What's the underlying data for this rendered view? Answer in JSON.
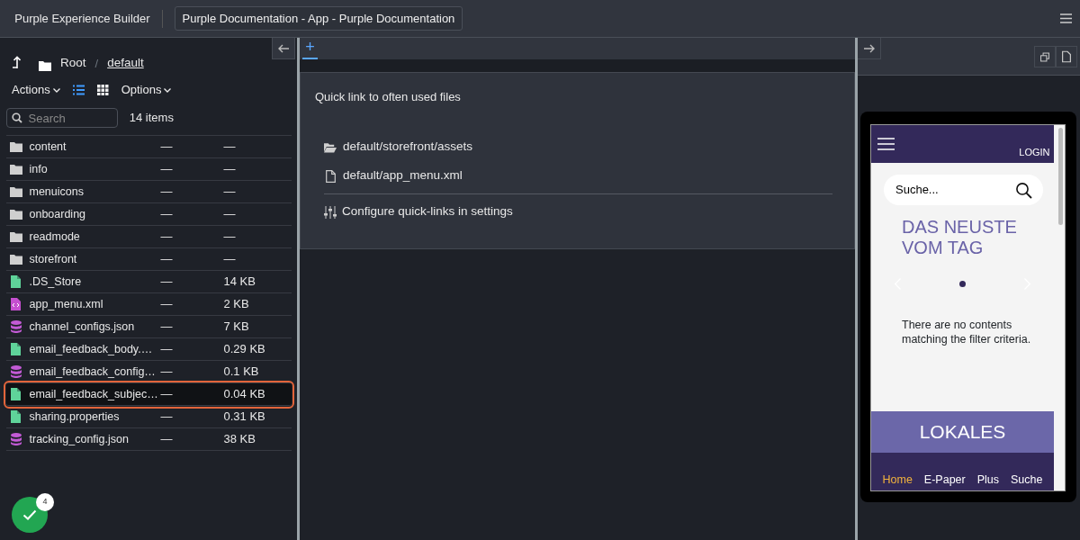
{
  "app": {
    "title": "Purple Experience Builder",
    "project": "Purple Documentation - App - Purple Documentation"
  },
  "browser": {
    "breadcrumb": [
      {
        "label": "Root",
        "current": false
      },
      {
        "label": "default",
        "current": true
      }
    ],
    "separator": "/",
    "actions": "Actions",
    "options": "Options",
    "view_modes": [
      {
        "kind": "list",
        "selected": true
      },
      {
        "kind": "grid",
        "selected": false
      }
    ],
    "search": {
      "placeholder": "Search"
    },
    "count": "14 items",
    "files": [
      {
        "kind": "folder",
        "name": "content",
        "modified": "—",
        "size": "—",
        "selected": false
      },
      {
        "kind": "folder",
        "name": "info",
        "modified": "—",
        "size": "—",
        "selected": false
      },
      {
        "kind": "folder",
        "name": "menuicons",
        "modified": "—",
        "size": "—",
        "selected": false
      },
      {
        "kind": "folder",
        "name": "onboarding",
        "modified": "—",
        "size": "—",
        "selected": false
      },
      {
        "kind": "folder",
        "name": "readmode",
        "modified": "—",
        "size": "—",
        "selected": false
      },
      {
        "kind": "folder",
        "name": "storefront",
        "modified": "—",
        "size": "—",
        "selected": false
      },
      {
        "kind": "file",
        "name": ".DS_Store",
        "modified": "—",
        "size": "14 KB",
        "selected": false
      },
      {
        "kind": "code",
        "name": "app_menu.xml",
        "modified": "—",
        "size": "2 KB",
        "selected": false
      },
      {
        "kind": "data",
        "name": "channel_configs.json",
        "modified": "—",
        "size": "7 KB",
        "selected": false
      },
      {
        "kind": "file",
        "name": "email_feedback_body.…",
        "modified": "—",
        "size": "0.29 KB",
        "selected": false
      },
      {
        "kind": "data",
        "name": "email_feedback_config…",
        "modified": "—",
        "size": "0.1 KB",
        "selected": false
      },
      {
        "kind": "file",
        "name": "email_feedback_subjec…",
        "modified": "—",
        "size": "0.04 KB",
        "selected": true
      },
      {
        "kind": "file",
        "name": "sharing.properties",
        "modified": "—",
        "size": "0.31 KB",
        "selected": false
      },
      {
        "kind": "data",
        "name": "tracking_config.json",
        "modified": "—",
        "size": "38 KB",
        "selected": false
      }
    ]
  },
  "editor": {
    "tabs": [
      {
        "label": "+",
        "selected": true
      }
    ],
    "quick_links": {
      "title": "Quick link to often used files",
      "links": [
        {
          "kind": "folder",
          "label": "default/storefront/assets"
        },
        {
          "kind": "file",
          "label": "default/app_menu.xml"
        }
      ],
      "settings_link": "Configure quick-links in settings"
    }
  },
  "preview": {
    "login": "LOGIN",
    "search_placeholder": "Suche...",
    "headline": "DAS NEUSTE VOM TAG",
    "empty_message": "There are no contents matching the filter criteria.",
    "section": "LOKALES",
    "nav": [
      {
        "label": "Home",
        "selected": true
      },
      {
        "label": "E-Paper",
        "selected": false
      },
      {
        "label": "Plus",
        "selected": false
      },
      {
        "label": "Suche",
        "selected": false
      }
    ]
  },
  "status": {
    "badge": "4"
  }
}
